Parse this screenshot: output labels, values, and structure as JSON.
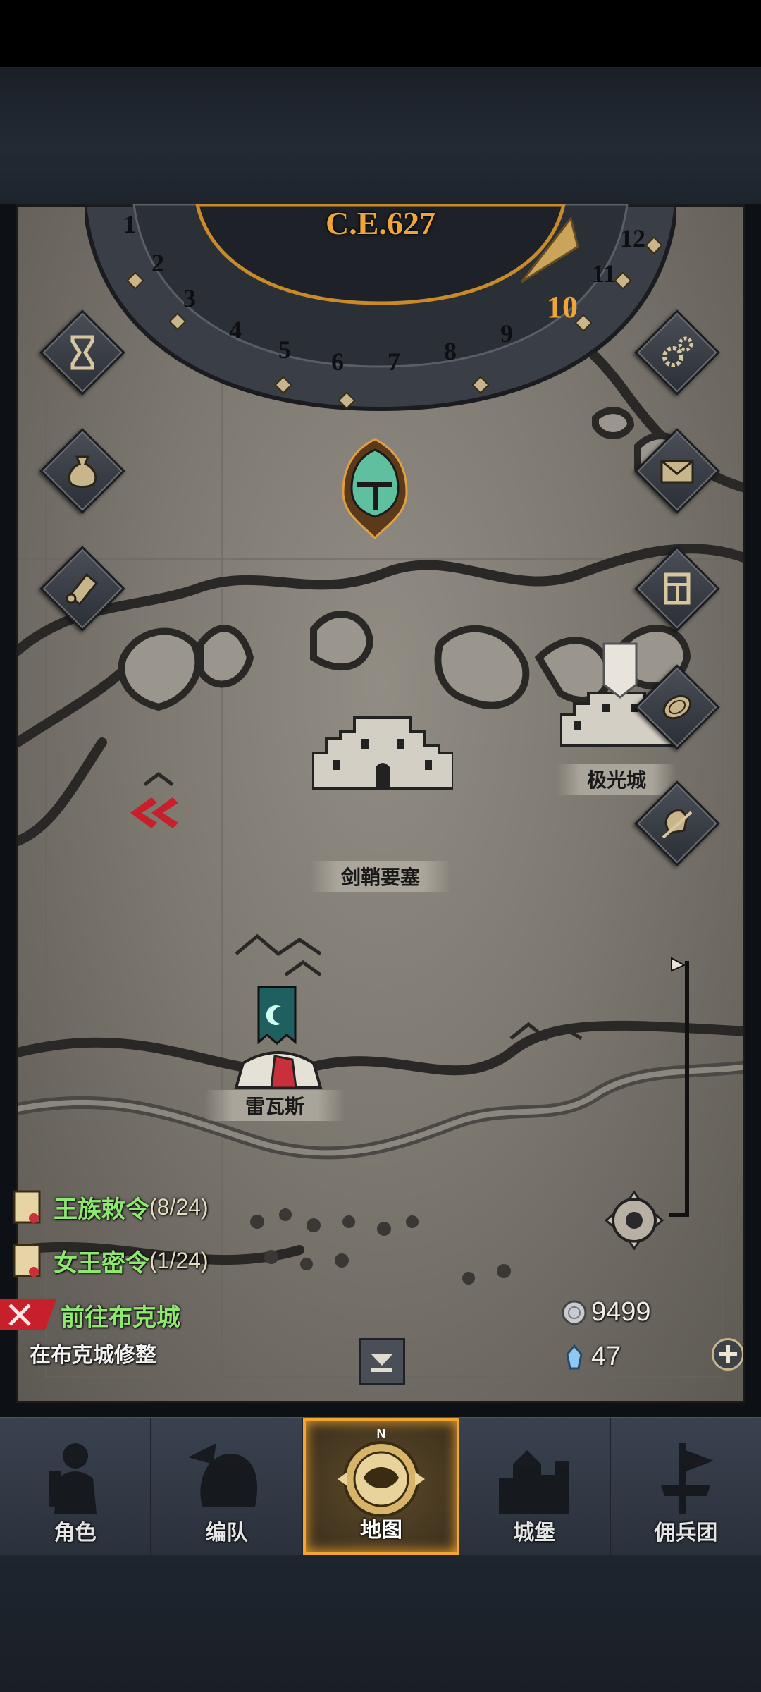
{
  "header": {
    "era_label": "C.E.627",
    "dial_numbers": [
      "1",
      "2",
      "3",
      "4",
      "5",
      "6",
      "7",
      "8",
      "9",
      "10",
      "11",
      "12"
    ],
    "current_month": "10"
  },
  "map": {
    "cities": [
      {
        "name": "剑鞘要塞"
      },
      {
        "name": "极光城"
      },
      {
        "name": "雷瓦斯"
      }
    ]
  },
  "side_buttons": {
    "left": [
      "hourglass-icon",
      "coin-bag-icon",
      "scroll-icon"
    ],
    "right": [
      "gear-icon",
      "mail-icon",
      "building-icon",
      "coin-icon",
      "helmet-sword-icon"
    ]
  },
  "quests": [
    {
      "title": "王族敕令",
      "progress": "(8/24)"
    },
    {
      "title": "女王密令",
      "progress": "(1/24)"
    }
  ],
  "current_task": {
    "title": "前往布克城",
    "subtitle": "在布克城修整"
  },
  "resources": {
    "silver": "9499",
    "crystal": "47"
  },
  "nav": {
    "compass_mark": "N",
    "items": [
      {
        "label": "角色"
      },
      {
        "label": "编队"
      },
      {
        "label": "地图"
      },
      {
        "label": "城堡"
      },
      {
        "label": "佣兵团"
      }
    ],
    "active_index": 2
  },
  "colors": {
    "accent": "#f3a531",
    "quest_green": "#8ee86f",
    "task_red": "#c8202a"
  }
}
